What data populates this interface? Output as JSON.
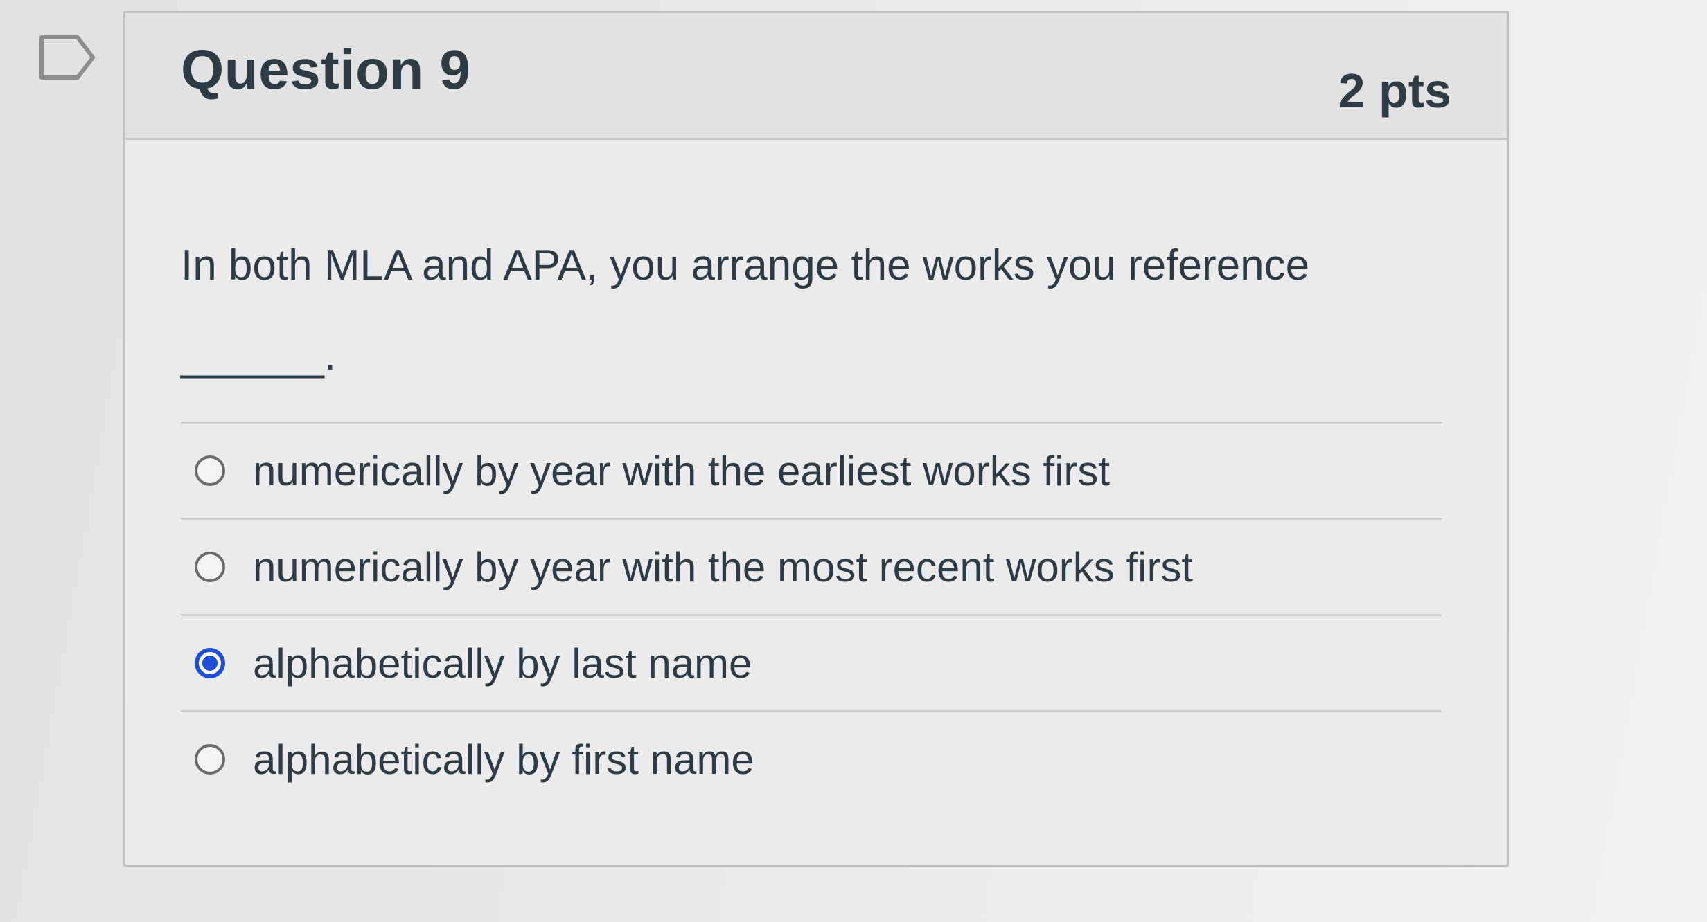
{
  "question": {
    "title": "Question 9",
    "points": "2 pts",
    "text": "In both MLA and APA, you arrange the works you reference",
    "blank": "______."
  },
  "flag": {
    "icon": "bookmark-flag-icon"
  },
  "answers": [
    {
      "label": "numerically by year with the earliest works first",
      "selected": false
    },
    {
      "label": "numerically by year with the most recent works first",
      "selected": false
    },
    {
      "label": "alphabetically by last name",
      "selected": true
    },
    {
      "label": "alphabetically by first name",
      "selected": false
    }
  ],
  "colors": {
    "selected_radio": "#1f4fd6",
    "text": "#2d3b45"
  }
}
